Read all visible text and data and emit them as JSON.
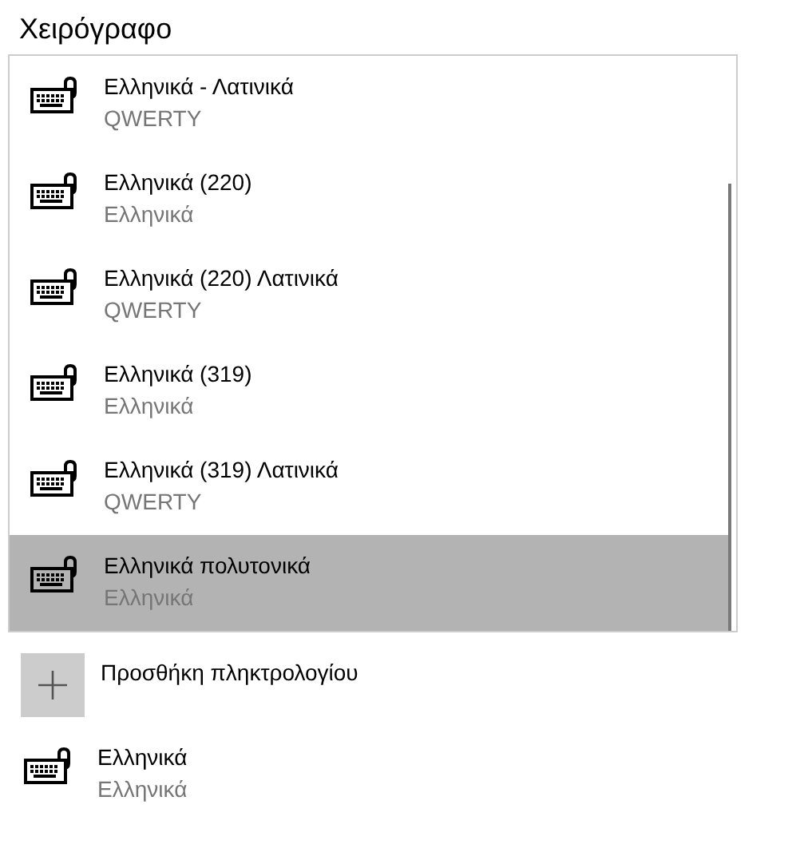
{
  "title": "Χειρόγραφο",
  "keyboards": [
    {
      "name": "Ελληνικά - Λατινικά",
      "layout": "QWERTY",
      "selected": false
    },
    {
      "name": "Ελληνικά (220)",
      "layout": "Ελληνικά",
      "selected": false
    },
    {
      "name": "Ελληνικά (220) Λατινικά",
      "layout": "QWERTY",
      "selected": false
    },
    {
      "name": "Ελληνικά (319)",
      "layout": "Ελληνικά",
      "selected": false
    },
    {
      "name": "Ελληνικά (319) Λατινικά",
      "layout": "QWERTY",
      "selected": false
    },
    {
      "name": "Ελληνικά πολυτονικά",
      "layout": "Ελληνικά",
      "selected": true
    }
  ],
  "add_button": {
    "label": "Προσθήκη πληκτρολογίου"
  },
  "installed": [
    {
      "name": "Ελληνικά",
      "layout": "Ελληνικά"
    }
  ]
}
